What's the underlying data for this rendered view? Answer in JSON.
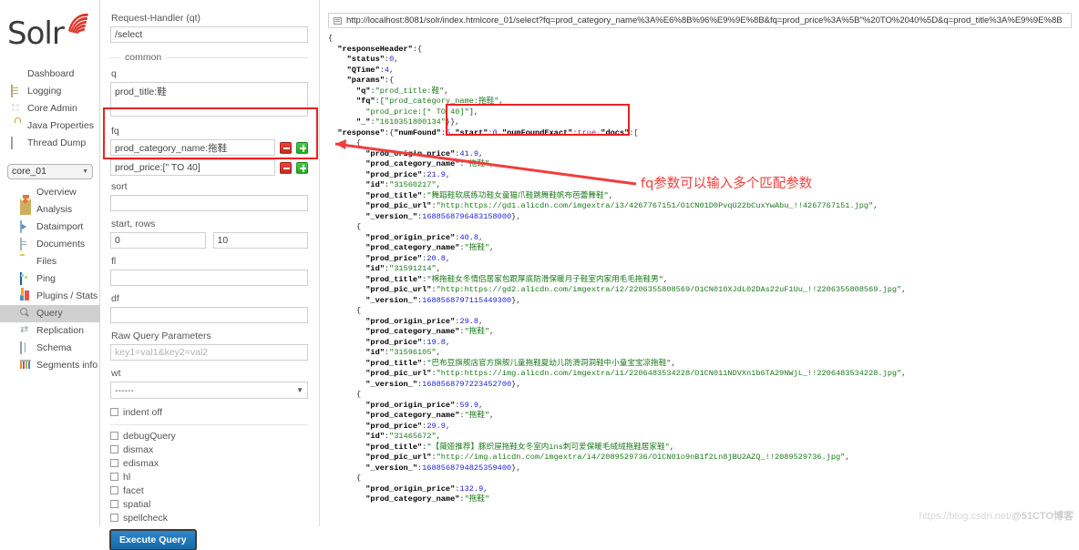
{
  "brand": {
    "name": "Solr",
    "logo_icon": "solr-sun-logo"
  },
  "sidebar": {
    "top_items": [
      {
        "label": "Dashboard",
        "icon": "cloud-icon"
      },
      {
        "label": "Logging",
        "icon": "envelope-icon"
      },
      {
        "label": "Core Admin",
        "icon": "grid-icon"
      },
      {
        "label": "Java Properties",
        "icon": "lock-icon"
      },
      {
        "label": "Thread Dump",
        "icon": "stack-icon"
      }
    ],
    "core_selector": {
      "value": "core_01",
      "caret_icon": "chevron-down-icon"
    },
    "core_items": [
      {
        "label": "Overview",
        "icon": "home-icon",
        "active": false
      },
      {
        "label": "Analysis",
        "icon": "funnel-icon",
        "active": false
      },
      {
        "label": "Dataimport",
        "icon": "import-icon",
        "active": false
      },
      {
        "label": "Documents",
        "icon": "page-icon",
        "active": false
      },
      {
        "label": "Files",
        "icon": "folder-icon",
        "active": false
      },
      {
        "label": "Ping",
        "icon": "ping-icon",
        "active": false
      },
      {
        "label": "Plugins / Stats",
        "icon": "plug-icon",
        "active": false
      },
      {
        "label": "Query",
        "icon": "search-icon",
        "active": true
      },
      {
        "label": "Replication",
        "icon": "replication-icon",
        "active": false
      },
      {
        "label": "Schema",
        "icon": "book-icon",
        "active": false
      },
      {
        "label": "Segments info",
        "icon": "segments-icon",
        "active": false
      }
    ]
  },
  "form": {
    "request_handler_label": "Request-Handler (qt)",
    "request_handler_value": "/select",
    "common_legend": "common",
    "q_label": "q",
    "q_value": "prod_title:鞋",
    "fq_label": "fq",
    "fq_values": [
      "prod_category_name:拖鞋",
      "prod_price:[\" TO 40]"
    ],
    "fq_remove_icon": "minus-button",
    "fq_add_icon": "plus-button",
    "sort_label": "sort",
    "sort_value": "",
    "start_rows_label": "start, rows",
    "start_value": "0",
    "rows_value": "10",
    "fl_label": "fl",
    "fl_value": "",
    "df_label": "df",
    "df_value": "",
    "raw_label": "Raw Query Parameters",
    "raw_placeholder": "key1=val1&key2=val2",
    "wt_label": "wt",
    "wt_value": "------",
    "indent_label": "indent off",
    "options": [
      "debugQuery",
      "dismax",
      "edismax",
      "hl",
      "facet",
      "spatial",
      "spellcheck"
    ],
    "execute_label": "Execute Query"
  },
  "result": {
    "url_icon": "link-icon",
    "url": "http://localhost:8081/solr/index.htmlcore_01/select?fq=prod_category_name%3A%E6%8B%96%E9%9E%8B&fq=prod_price%3A%5B\"%20TO%2040%5D&q=prod_title%3A%E9%9E%8B",
    "response_header": {
      "status": 0,
      "QTime": 4,
      "params": {
        "q": "prod_title:鞋",
        "fq": [
          "prod_category_name:拖鞋",
          "prod_price:[* TO 40]"
        ],
        "_": "1610351800134"
      }
    },
    "response": {
      "numFound": 5,
      "start": 0,
      "numFoundExact": true,
      "docs": [
        {
          "prod_origin_price": 41.9,
          "prod_category_name": "拖鞋",
          "prod_price": 21.9,
          "id": "31560217",
          "prod_title": "舞蹈鞋软底练功鞋女童猫爪鞋跳舞鞋帆布芭蕾舞鞋",
          "prod_pic_url": "http:https://gd1.alicdn.com/imgextra/i3/4267767151/O1CN01D0PvqU22bCuxYwAbu_!!4267767151.jpg",
          "_version_": 1688568796483158024
        },
        {
          "prod_origin_price": 40.8,
          "prod_category_name": "拖鞋",
          "prod_price": 20.8,
          "id": "31591214",
          "prod_title": "棉拖鞋女冬情侣居家包跟厚底防滑保暖月子鞋室内家用毛毛拖鞋男",
          "prod_pic_url": "http:https://gd2.alicdn.com/imgextra/i2/2206355808569/O1CN010XJdL02DAs22uF1Uu_!!2206355808569.jpg",
          "_version_": 1688568797115449359
        },
        {
          "prod_origin_price": 29.8,
          "prod_category_name": "拖鞋",
          "prod_price": 19.8,
          "id": "31596105",
          "prod_title": "巴布豆旗舰店官方旗舰儿童拖鞋夏幼儿防滑洞洞鞋中小童宝宝凉拖鞋",
          "prod_pic_url": "http:https://img.alicdn.com/imgextra/i1/2206483534228/O1CN011NDVXn1b6TA29NWjL_!!2206483534228.jpg",
          "_version_": 1688568797223452684
        },
        {
          "prod_origin_price": 59.9,
          "prod_category_name": "拖鞋",
          "prod_price": 29.9,
          "id": "31465672",
          "prod_title": "【薇娅推荐】豚织屋拖鞋女冬室内ins刺可爱保暖毛绒绒拖鞋居家鞋",
          "prod_pic_url": "http://img.alicdn.com/imgextra/i4/2089529736/O1CN01o9nB1f2Ln8jBU2AZQ_!!2089529736.jpg",
          "_version_": 1688568794825359370
        },
        {
          "prod_origin_price": 132.9,
          "prod_category_name": "拖鞋"
        }
      ]
    }
  },
  "annotation": {
    "note": "fq参数可以输入多个匹配参数",
    "highlight_color": "#ef2020"
  },
  "watermark": {
    "url": "https://blog.csdn.net/",
    "tag": "@51CTO博客"
  }
}
